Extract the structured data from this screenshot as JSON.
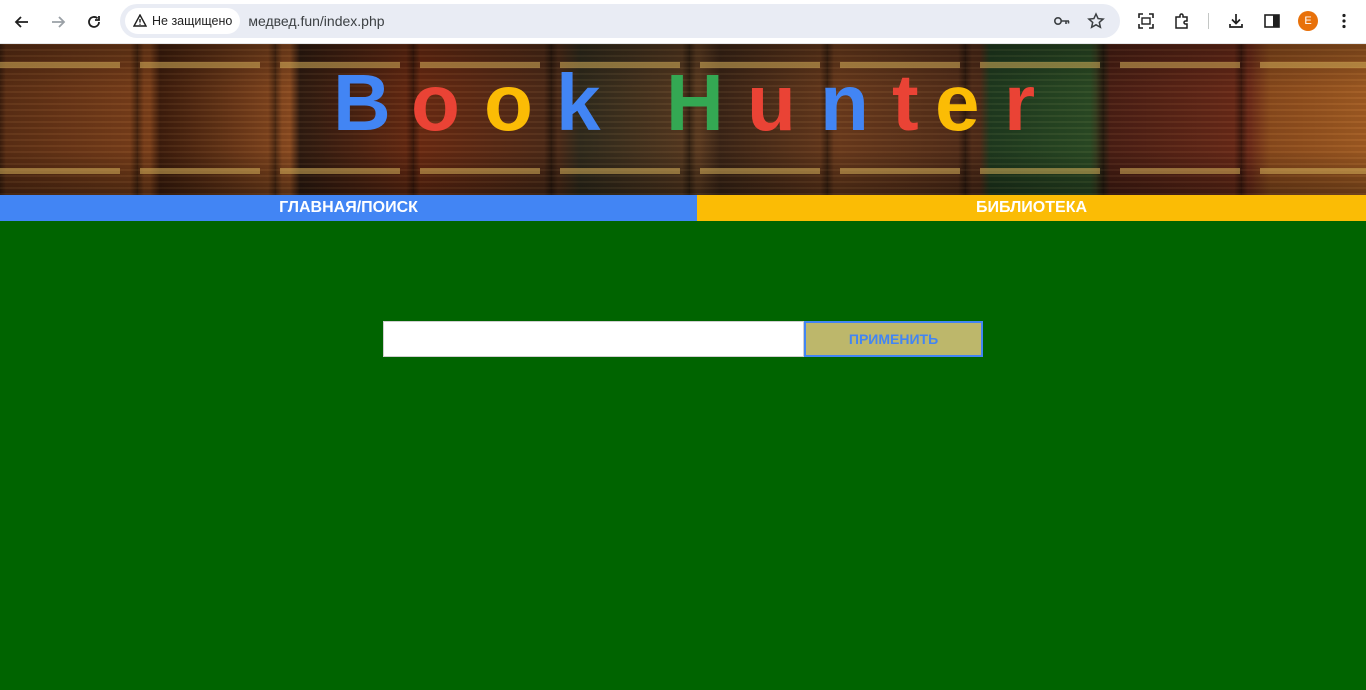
{
  "browser": {
    "security_label": "Не защищено",
    "url": "медвед.fun/index.php",
    "profile_initial": "E",
    "icons": [
      "back-icon",
      "forward-icon",
      "reload-icon",
      "warning-icon",
      "key-icon",
      "star-icon",
      "screenshot-icon",
      "extensions-icon",
      "download-icon",
      "sidepanel-icon",
      "menu-icon"
    ]
  },
  "banner": {
    "title_letters": [
      {
        "char": "B",
        "color": "#4285f4"
      },
      {
        "char": "o",
        "color": "#ea4335"
      },
      {
        "char": "o",
        "color": "#fbbc05"
      },
      {
        "char": "k",
        "color": "#4285f4"
      },
      {
        "char": "H",
        "color": "#34a853"
      },
      {
        "char": "u",
        "color": "#ea4335"
      },
      {
        "char": "n",
        "color": "#4285f4"
      },
      {
        "char": "t",
        "color": "#ea4335"
      },
      {
        "char": "e",
        "color": "#fbbc05"
      },
      {
        "char": "r",
        "color": "#ea4335"
      }
    ]
  },
  "nav": {
    "home_label": "ГЛАВНАЯ/ПОИСК",
    "library_label": "БИБЛИОТЕКА",
    "home_color": "#4285f4",
    "library_color": "#fbbc05"
  },
  "search": {
    "value": "",
    "placeholder": "",
    "button_label": "ПРИМЕНИТЬ"
  },
  "colors": {
    "page_background": "#006400",
    "button_background": "#bdb76b"
  }
}
